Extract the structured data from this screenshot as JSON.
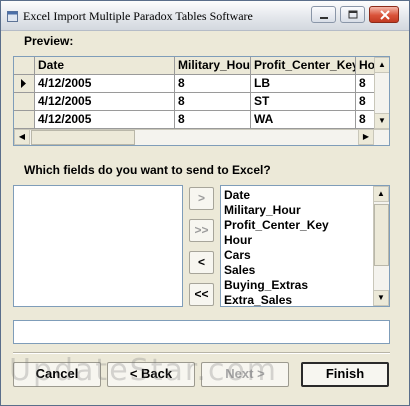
{
  "window": {
    "title": "Excel Import Multiple Paradox Tables Software",
    "app_icon": "app-icon",
    "controls": [
      "minimize-icon",
      "maximize-icon",
      "close-icon"
    ]
  },
  "preview": {
    "label": "Preview:",
    "columns": [
      "Date",
      "Military_Hour",
      "Profit_Center_Key",
      "Hou"
    ],
    "rows": [
      [
        "4/12/2005",
        "8",
        "LB",
        "8"
      ],
      [
        "4/12/2005",
        "8",
        "ST",
        "8"
      ],
      [
        "4/12/2005",
        "8",
        "WA",
        "8"
      ]
    ],
    "current_row_marker": "row-pointer-icon"
  },
  "fields": {
    "question": "Which fields do you want to send to Excel?",
    "selected": [],
    "available": [
      "Date",
      "Military_Hour",
      "Profit_Center_Key",
      "Hour",
      "Cars",
      "Sales",
      "Buying_Extras",
      "Extra_Sales"
    ]
  },
  "move_buttons": {
    "add_one": ">",
    "add_all": ">>",
    "remove_one": "<",
    "remove_all": "<<"
  },
  "status": {
    "text": ""
  },
  "nav": {
    "cancel": "Cancel",
    "back": "< Back",
    "next": "Next >",
    "finish": "Finish"
  },
  "watermark": "UpdateStar.com"
}
